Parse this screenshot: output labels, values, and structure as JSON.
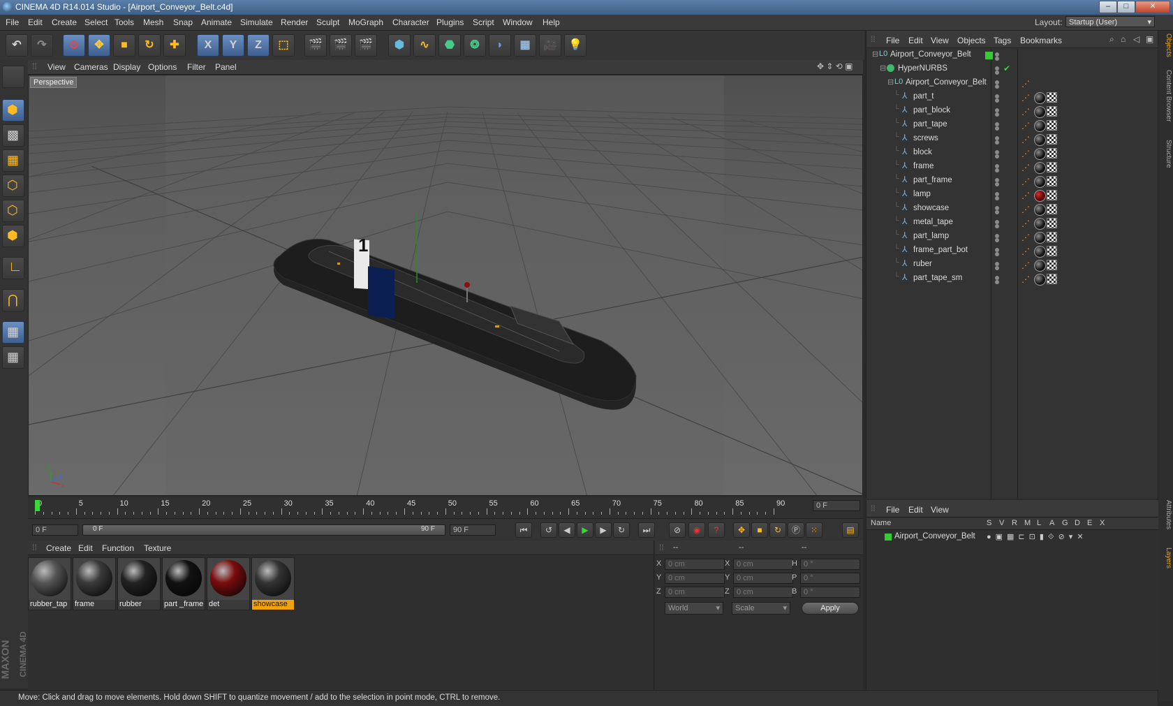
{
  "window": {
    "title": "CINEMA 4D R14.014 Studio - [Airport_Conveyor_Belt.c4d]",
    "buttons": [
      "–",
      "□",
      "✕"
    ]
  },
  "menubar": {
    "items": [
      "File",
      "Edit",
      "Create",
      "Select",
      "Tools",
      "Mesh",
      "Snap",
      "Animate",
      "Simulate",
      "Render",
      "Sculpt",
      "MoGraph",
      "Character",
      "Plugins",
      "Script",
      "Window",
      "Help"
    ],
    "layout_label": "Layout:",
    "layout_value": "Startup (User)"
  },
  "toolbar": {
    "x_label": "X",
    "y_label": "Y",
    "z_label": "Z"
  },
  "viewport": {
    "menu": [
      "View",
      "Cameras",
      "Display",
      "Options",
      "Filter",
      "Panel"
    ],
    "label": "Perspective",
    "sign_text": "1"
  },
  "object_manager": {
    "menu": [
      "File",
      "Edit",
      "View",
      "Objects",
      "Tags",
      "Bookmarks"
    ],
    "objects": [
      {
        "name": "Airport_Conveyor_Belt",
        "level": 0,
        "type": "null"
      },
      {
        "name": "HyperNURBS",
        "level": 1,
        "type": "nurbs"
      },
      {
        "name": "Airport_Conveyor_Belt",
        "level": 2,
        "type": "null"
      },
      {
        "name": "part_t",
        "level": 3,
        "type": "poly"
      },
      {
        "name": "part_block",
        "level": 3,
        "type": "poly"
      },
      {
        "name": "part_tape",
        "level": 3,
        "type": "poly"
      },
      {
        "name": "screws",
        "level": 3,
        "type": "poly"
      },
      {
        "name": "block",
        "level": 3,
        "type": "poly"
      },
      {
        "name": "frame",
        "level": 3,
        "type": "poly"
      },
      {
        "name": "part_frame",
        "level": 3,
        "type": "poly"
      },
      {
        "name": "lamp",
        "level": 3,
        "type": "poly",
        "red": true
      },
      {
        "name": "showcase",
        "level": 3,
        "type": "poly"
      },
      {
        "name": "metal_tape",
        "level": 3,
        "type": "poly"
      },
      {
        "name": "part_lamp",
        "level": 3,
        "type": "poly"
      },
      {
        "name": "frame_part_bot",
        "level": 3,
        "type": "poly"
      },
      {
        "name": "ruber",
        "level": 3,
        "type": "poly"
      },
      {
        "name": "part_tape_sm",
        "level": 3,
        "type": "poly"
      }
    ]
  },
  "side_tabs": [
    "Objects",
    "Content Browser",
    "Structure",
    "Attributes",
    "Layers"
  ],
  "timeline": {
    "ticks": [
      "0",
      "5",
      "10",
      "15",
      "20",
      "25",
      "30",
      "35",
      "40",
      "45",
      "50",
      "55",
      "60",
      "65",
      "70",
      "75",
      "80",
      "85",
      "90"
    ],
    "current_frame": "0 F",
    "start": "0 F",
    "slider_start": "0 F",
    "slider_end": "90 F",
    "end": "90 F"
  },
  "material_manager": {
    "menu": [
      "Create",
      "Edit",
      "Function",
      "Texture"
    ],
    "materials": [
      {
        "name": "rubber_tap",
        "color": "#555555"
      },
      {
        "name": "frame",
        "color": "#3a3a3a"
      },
      {
        "name": "rubber",
        "color": "#222222"
      },
      {
        "name": "part _frame",
        "color": "#111111"
      },
      {
        "name": "det",
        "color": "#7a0c0c"
      },
      {
        "name": "showcase",
        "color": "#333333",
        "selected": true
      }
    ]
  },
  "coordinates": {
    "headers": [
      "--",
      "--",
      "--"
    ],
    "rows": [
      {
        "a": "X",
        "av": "0 cm",
        "b": "X",
        "bv": "0 cm",
        "c": "H",
        "cv": "0 °"
      },
      {
        "a": "Y",
        "av": "0 cm",
        "b": "Y",
        "bv": "0 cm",
        "c": "P",
        "cv": "0 °"
      },
      {
        "a": "Z",
        "av": "0 cm",
        "b": "Z",
        "bv": "0 cm",
        "c": "B",
        "cv": "0 °"
      }
    ],
    "mode": "World",
    "scale": "Scale",
    "apply": "Apply"
  },
  "layer_manager": {
    "menu": [
      "File",
      "Edit",
      "View"
    ],
    "columns": [
      "Name",
      "S",
      "V",
      "R",
      "M",
      "L",
      "A",
      "G",
      "D",
      "E",
      "X"
    ],
    "layers": [
      "Airport_Conveyor_Belt"
    ]
  },
  "status": "Move: Click and drag to move elements. Hold down SHIFT to quantize movement / add to the selection in point mode, CTRL to remove.",
  "brand": {
    "line1": "MAXON",
    "line2": "CINEMA 4D"
  },
  "colors": {
    "accent_blue": "#5a82b8",
    "selected_orange": "#f0a30a",
    "layer_green": "#33cc33"
  }
}
